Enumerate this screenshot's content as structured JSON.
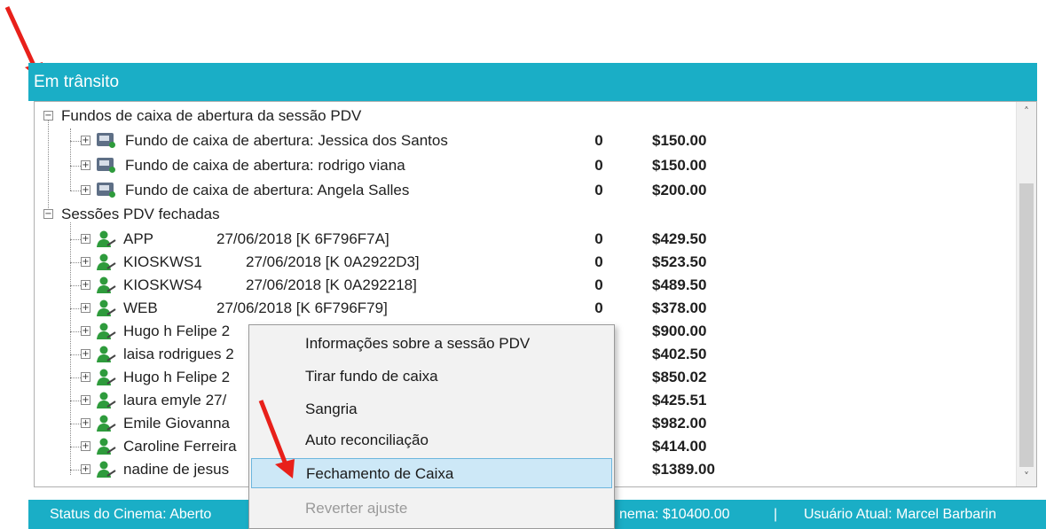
{
  "panel": {
    "title": "Em trânsito"
  },
  "tree": {
    "group1": {
      "label": "Fundos de caixa de abertura da sessão PDV"
    },
    "group1_items": [
      {
        "label": "Fundo de caixa de abertura: Jessica dos Santos",
        "qty": "0",
        "amount": "$150.00"
      },
      {
        "label": "Fundo de caixa de abertura: rodrigo viana",
        "qty": "0",
        "amount": "$150.00"
      },
      {
        "label": "Fundo de caixa de abertura: Angela Salles",
        "qty": "0",
        "amount": "$200.00"
      }
    ],
    "group2": {
      "label": "Sessões PDV fechadas"
    },
    "group2_items": [
      {
        "name": "APP",
        "detail": "27/06/2018 [K 6F796F7A]",
        "qty": "0",
        "amount": "$429.50"
      },
      {
        "name": "KIOSKWS1",
        "detail": "27/06/2018 [K 0A2922D3]",
        "qty": "0",
        "amount": "$523.50"
      },
      {
        "name": "KIOSKWS4",
        "detail": "27/06/2018 [K 0A292218]",
        "qty": "0",
        "amount": "$489.50"
      },
      {
        "name": "WEB",
        "detail": "27/06/2018 [K 6F796F79]",
        "qty": "0",
        "amount": "$378.00"
      },
      {
        "name": "Hugo h Felipe 2",
        "detail": "",
        "qty": "",
        "amount": "$900.00"
      },
      {
        "name": "laisa rodrigues 2",
        "detail": "",
        "qty": "",
        "amount": "$402.50"
      },
      {
        "name": "Hugo h Felipe 2",
        "detail": "",
        "qty": "",
        "amount": "$850.02"
      },
      {
        "name": "laura emyle 27/",
        "detail": "",
        "qty": "",
        "amount": "$425.51"
      },
      {
        "name": "Emile Giovanna",
        "detail": "",
        "qty": "",
        "amount": "$982.00"
      },
      {
        "name": "Caroline Ferreira",
        "detail": "",
        "qty": "",
        "amount": "$414.00"
      },
      {
        "name": "nadine de jesus",
        "detail": "",
        "qty": "",
        "amount": "$1389.00"
      }
    ]
  },
  "context_menu": {
    "items": [
      {
        "label": "Informações sobre a sessão PDV"
      },
      {
        "label": "Tirar fundo de caixa"
      },
      {
        "label": "Sangria"
      },
      {
        "label": "Auto reconciliação"
      },
      {
        "label": "Fechamento de Caixa"
      },
      {
        "label": "Reverter ajuste"
      }
    ],
    "selected_index": 4,
    "disabled_index": 5
  },
  "status_bar": {
    "cinema_status": "Status do Cinema: Aberto",
    "total": "nema: $10400.00",
    "separator": "|",
    "current_user": "Usuário Atual: Marcel Barbarin"
  },
  "colors": {
    "header_teal": "#1aaec6",
    "annotation_arrow": "#e8201a",
    "selection": "#cde8f7",
    "user_icon_green": "#2e9b3c"
  },
  "icons": {
    "expander": "plus-box-icon",
    "collapse": "minus-box-icon",
    "monitor": "monitor-icon",
    "user": "user-icon",
    "scroll_up": "chevron-up-icon",
    "scroll_down": "chevron-down-icon"
  }
}
